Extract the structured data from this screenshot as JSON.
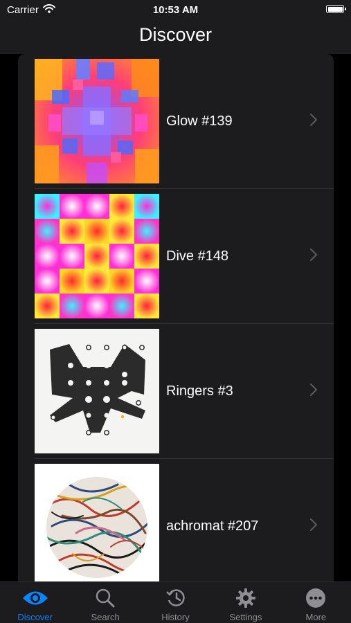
{
  "status_bar": {
    "carrier": "Carrier",
    "time": "10:53 AM"
  },
  "nav": {
    "title": "Discover"
  },
  "items": [
    {
      "title": "Glow #139"
    },
    {
      "title": "Dive #148"
    },
    {
      "title": "Ringers #3"
    },
    {
      "title": "achromat #207"
    }
  ],
  "tabs": [
    {
      "label": "Discover",
      "icon": "eye-icon",
      "active": true
    },
    {
      "label": "Search",
      "icon": "magnifying-glass-icon"
    },
    {
      "label": "History",
      "icon": "clock-history-icon"
    },
    {
      "label": "Settings",
      "icon": "gear-icon"
    },
    {
      "label": "More",
      "icon": "ellipsis-circle-icon"
    }
  ],
  "colors": {
    "accent": "#0a84ff",
    "inactive": "#8e8e93",
    "background": "#000000",
    "surface": "#1c1c1e"
  }
}
